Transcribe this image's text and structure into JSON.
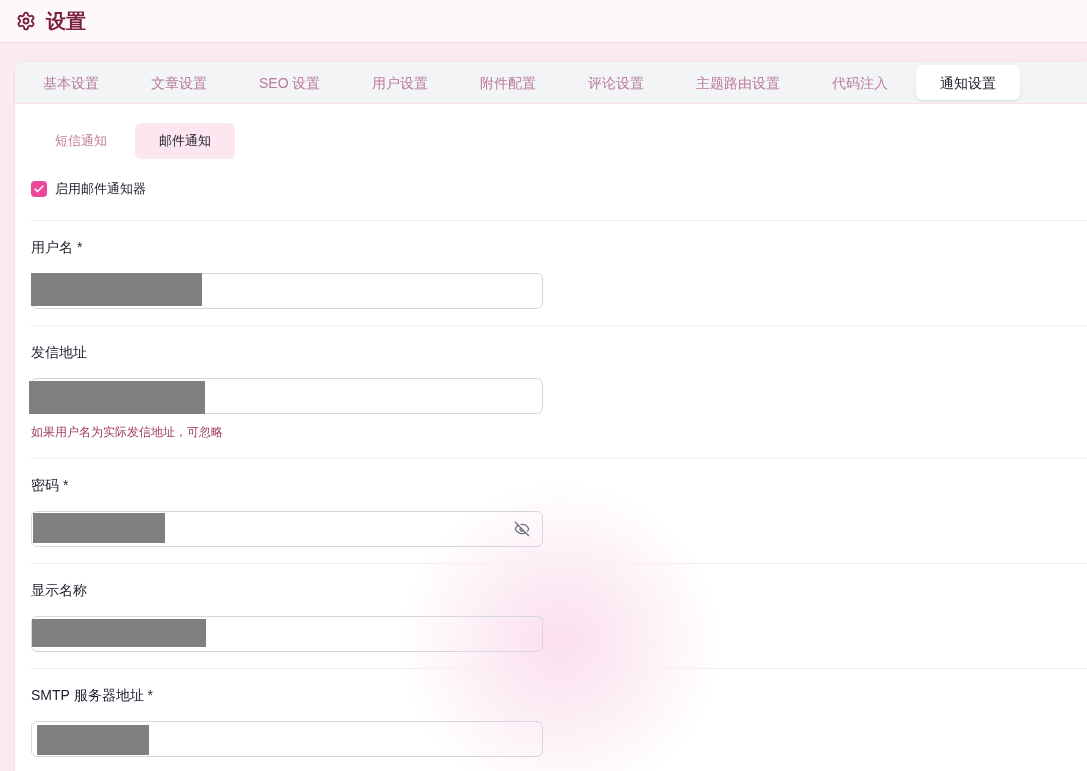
{
  "header": {
    "title": "设置"
  },
  "tabs": [
    {
      "label": "基本设置",
      "selected": false
    },
    {
      "label": "文章设置",
      "selected": false
    },
    {
      "label": "SEO 设置",
      "selected": false
    },
    {
      "label": "用户设置",
      "selected": false
    },
    {
      "label": "附件配置",
      "selected": false
    },
    {
      "label": "评论设置",
      "selected": false
    },
    {
      "label": "主题路由设置",
      "selected": false
    },
    {
      "label": "代码注入",
      "selected": false
    },
    {
      "label": "通知设置",
      "selected": true
    }
  ],
  "sub_tabs": [
    {
      "label": "短信通知",
      "selected": false
    },
    {
      "label": "邮件通知",
      "selected": true
    }
  ],
  "enable_checkbox": {
    "label": "启用邮件通知器",
    "checked": true
  },
  "fields": [
    {
      "label": "用户名 *",
      "kind": "text",
      "redacted": true
    },
    {
      "label": "发信地址",
      "kind": "text",
      "redacted": true,
      "hint": "如果用户名为实际发信地址，可忽略"
    },
    {
      "label": "密码 *",
      "kind": "password",
      "redacted": true
    },
    {
      "label": "显示名称",
      "kind": "text",
      "redacted": true
    },
    {
      "label": "SMTP 服务器地址 *",
      "kind": "text",
      "redacted": true
    }
  ]
}
